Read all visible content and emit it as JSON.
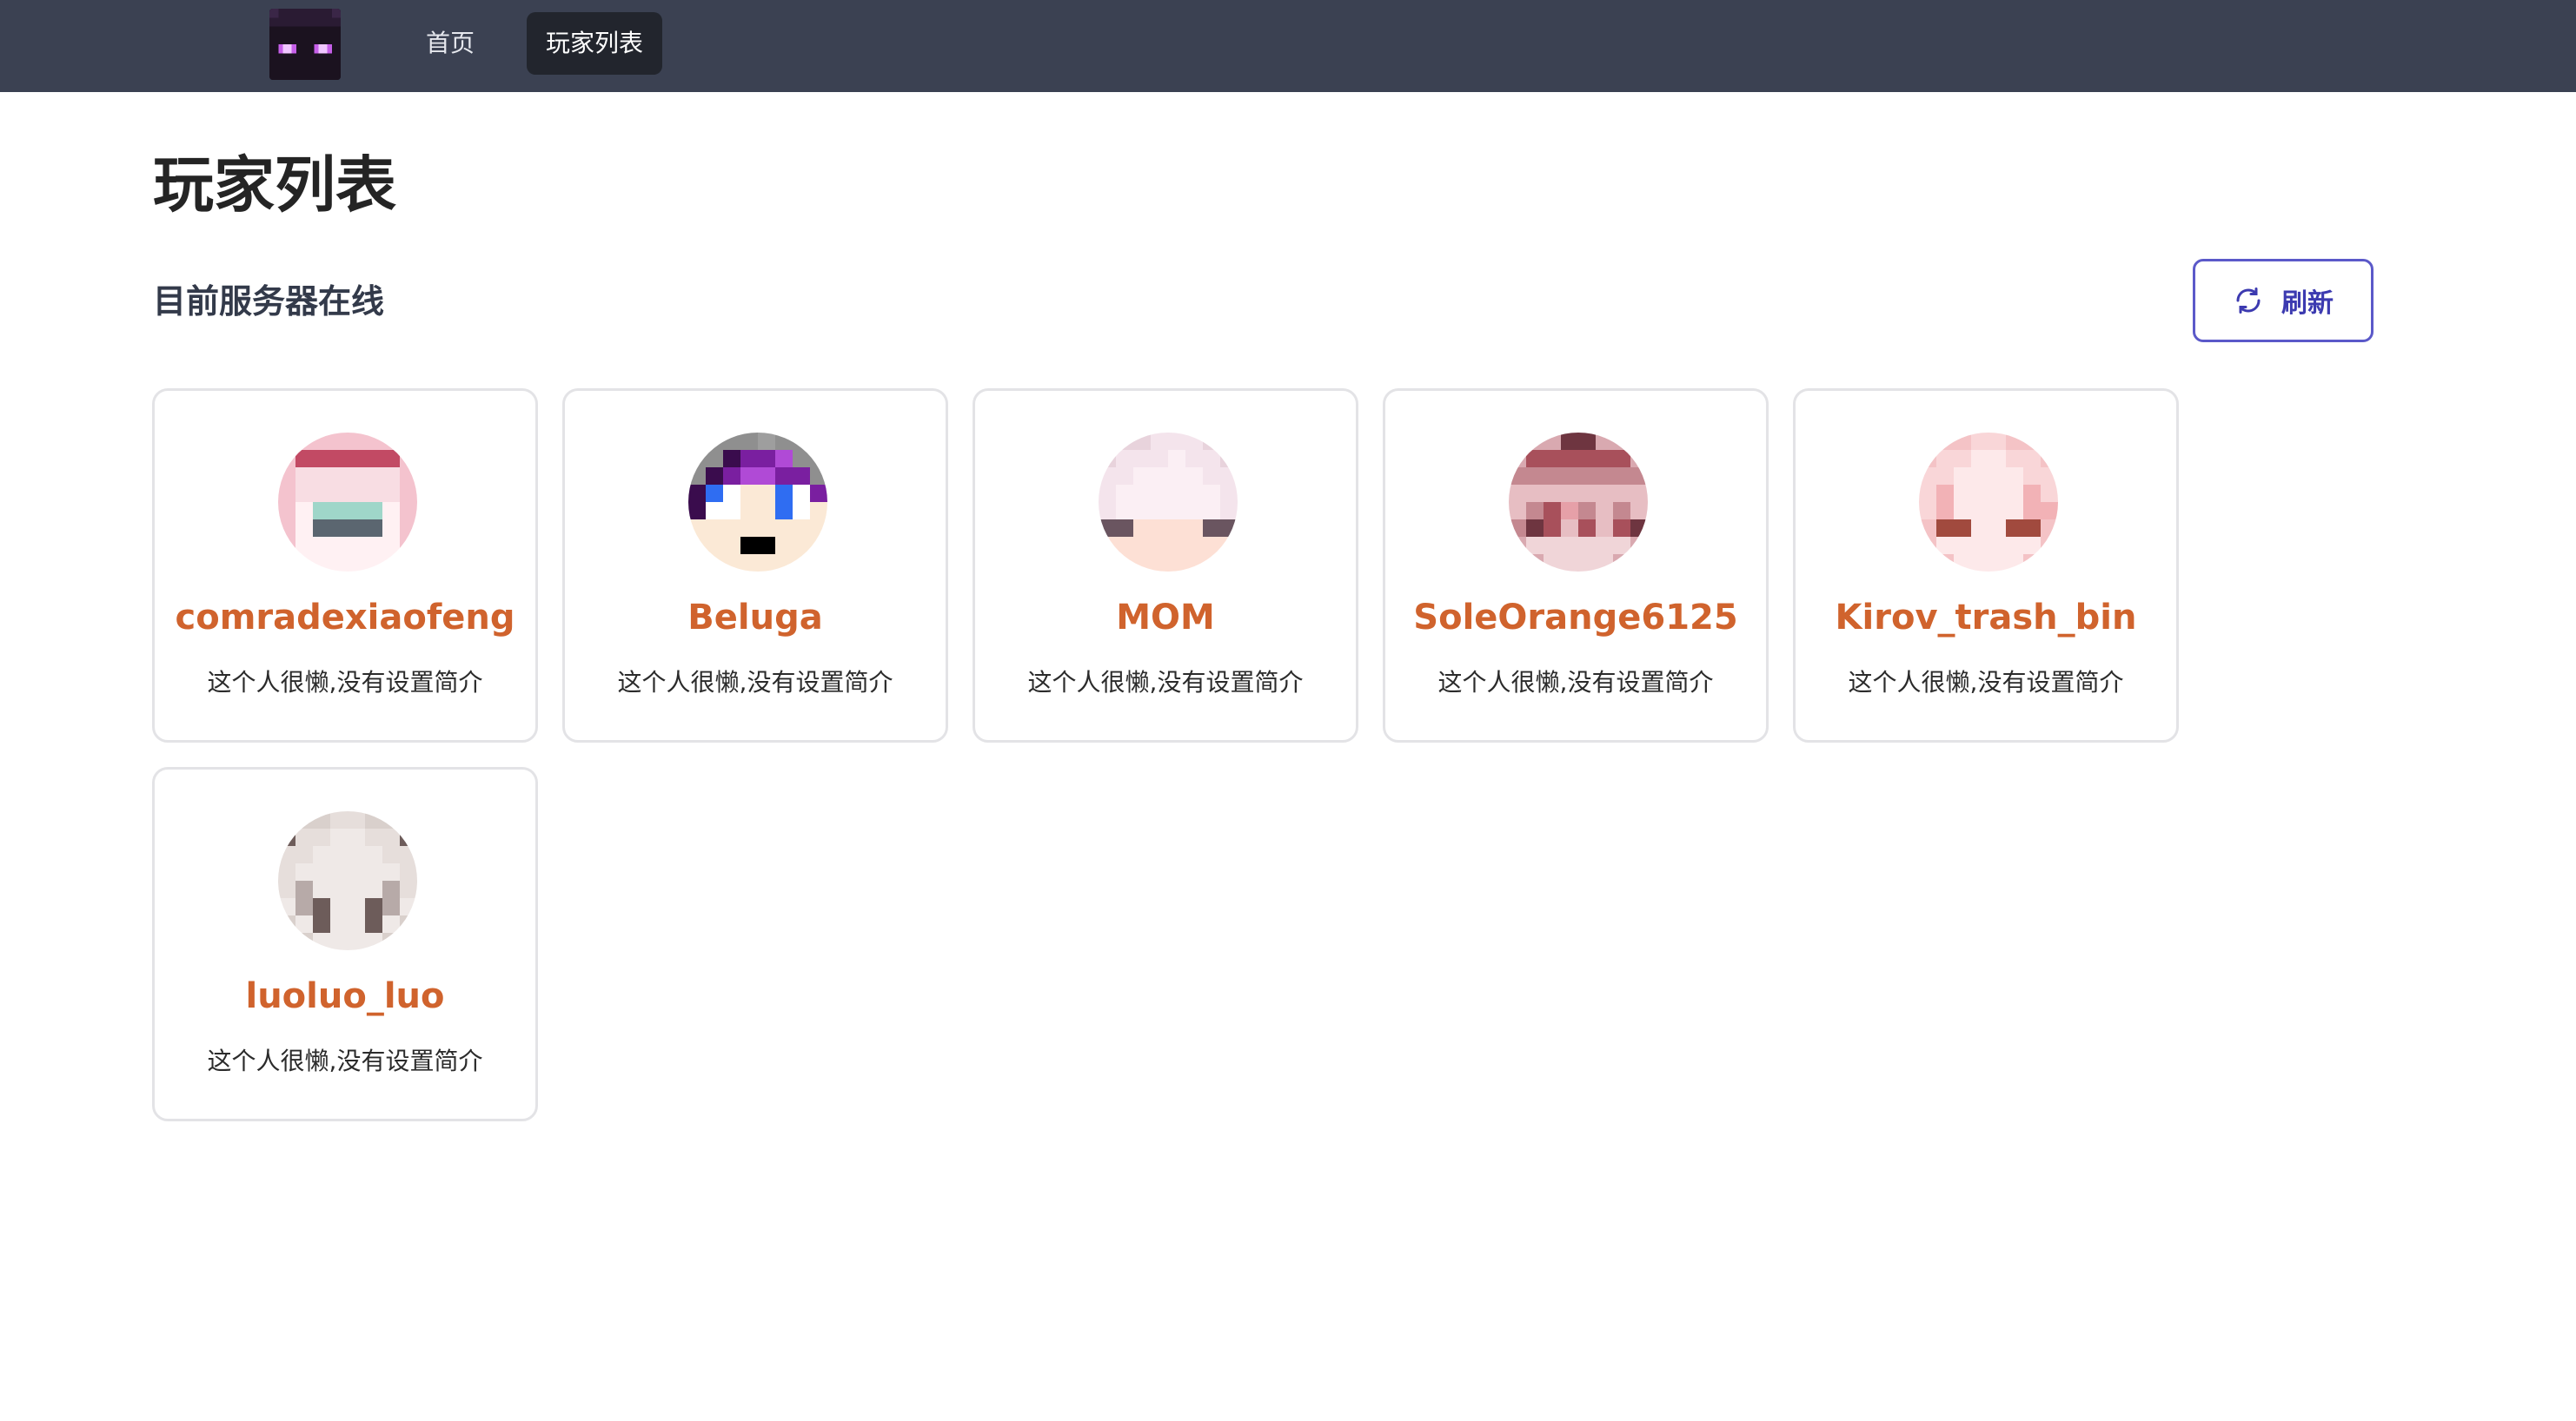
{
  "nav": {
    "logo": "enderman-logo",
    "items": [
      "首页",
      "玩家列表"
    ],
    "active": "玩家列表"
  },
  "page": {
    "title": "玩家列表",
    "section_title": "目前服务器在线",
    "refresh_label": "刷新",
    "refresh_icon": "refresh-icon"
  },
  "players": [
    {
      "name": "comradexiaofeng",
      "bio": "这个人很懒,没有设置简介"
    },
    {
      "name": "Beluga",
      "bio": "这个人很懒,没有设置简介"
    },
    {
      "name": "MOM",
      "bio": "这个人很懒,没有设置简介"
    },
    {
      "name": "SoleOrange6125",
      "bio": "这个人很懒,没有设置简介"
    },
    {
      "name": "Kirov_trash_bin",
      "bio": "这个人很懒,没有设置简介"
    },
    {
      "name": "luoluo_luo",
      "bio": "这个人很懒,没有设置简介"
    }
  ],
  "colors": {
    "nav_bg": "#3b4152",
    "accent": "#5b59c9",
    "player_name": "#d0632d"
  }
}
